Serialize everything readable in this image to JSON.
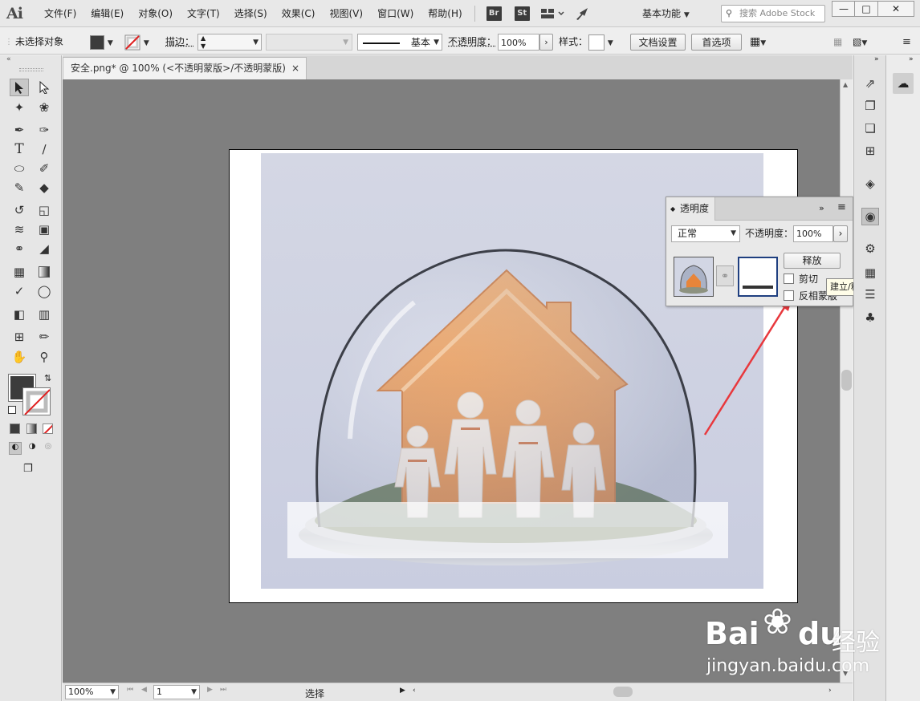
{
  "app": {
    "logo": "Ai"
  },
  "menu": [
    "文件(F)",
    "编辑(E)",
    "对象(O)",
    "文字(T)",
    "选择(S)",
    "效果(C)",
    "视图(V)",
    "窗口(W)",
    "帮助(H)"
  ],
  "menubar_extra": {
    "br": "Br",
    "st": "St",
    "workspace": "基本功能",
    "search_placeholder": "搜索 Adobe Stock"
  },
  "window_buttons": {
    "minimize": "—",
    "restore": "□",
    "close": "✕"
  },
  "control_bar": {
    "selection_status": "未选择对象",
    "stroke_label": "描边：",
    "stroke_style": "基本",
    "opacity_label": "不透明度：",
    "opacity_value": "100%",
    "style_label": "样式：",
    "doc_setup_button": "文档设置",
    "preferences_button": "首选项"
  },
  "document_tab": {
    "title": "安全.png* @ 100% (<不透明蒙版>/不透明蒙版)",
    "close": "×"
  },
  "transparency_panel": {
    "title": "透明度",
    "blend_mode": "正常",
    "opacity_label": "不透明度：",
    "opacity_value": "100%",
    "release_button": "释放",
    "clip_label": "剪切",
    "invert_label": "反相蒙版",
    "clip_checked": false,
    "invert_checked": false
  },
  "tooltip": "建立/释放不透明度蒙版",
  "status_bar": {
    "zoom": "100%",
    "artboard_number": "1",
    "tool_status": "选择"
  },
  "watermark": {
    "brand": "Bai",
    "brand_suffix": "du",
    "cn": "经验",
    "url": "jingyan.baidu.com"
  },
  "colors": {
    "accent_arrow": "#e8383d",
    "house": "#e8853a",
    "canvas_bg": "#7f7f7f"
  }
}
